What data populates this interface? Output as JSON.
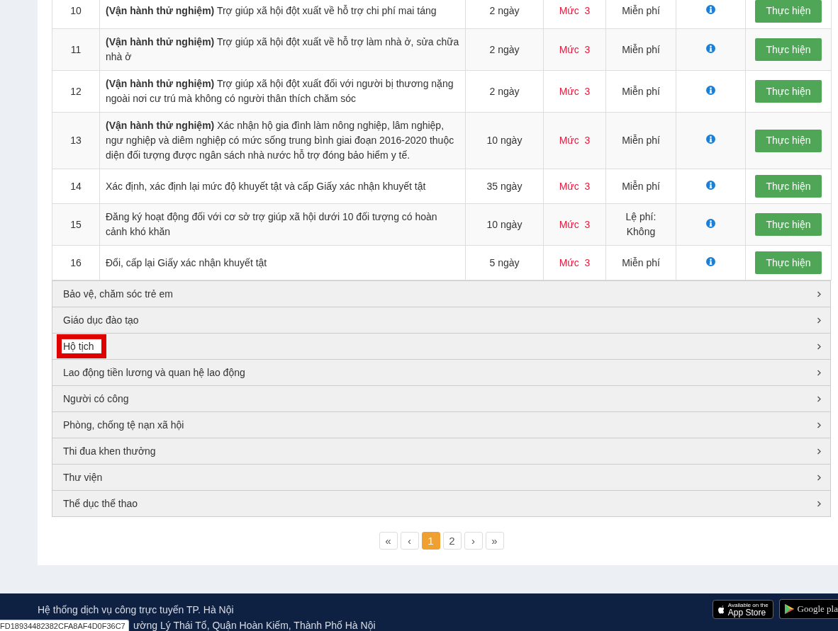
{
  "procedures": [
    {
      "column_1": "10",
      "column_2": "**(Vận hành thử nghiệm)** Trợ giúp xã hội đột xuất về hỗ trợ chi phí mai táng",
      "column_3": "2 ngày",
      "column_4": "Mức  3",
      "column_5": "Miễn phí",
      "button": "Thực hiện"
    },
    {
      "column_1": "11",
      "column_2": "**(Vận hành thử nghiệm)** Trợ giúp xã hội đột xuất về hỗ trợ làm nhà ở, sửa chữa nhà ở",
      "column_3": "2 ngày",
      "column_4": "Mức  3",
      "column_5": "Miễn phí",
      "button": "Thực hiện"
    },
    {
      "column_1": "12",
      "column_2": "**(Vận hành thử nghiệm)** Trợ giúp xã hội đột xuất đối với người bị thương nặng ngoài nơi cư trú mà không có người thân thích chăm sóc",
      "column_3": "2 ngày",
      "column_4": "Mức  3",
      "column_5": "Miễn phí",
      "button": "Thực hiện"
    },
    {
      "column_1": "13",
      "column_2": "**(Vận hành thử nghiệm)** Xác nhận hộ gia đình làm nông nghiệp, lâm nghiệp, ngư nghiệp và diêm nghiệp có mức sống trung bình giai đoạn 2016-2020 thuộc diện đối tượng được ngân sách nhà nước hỗ trợ đóng bảo hiểm y tế.",
      "column_3": "10 ngày",
      "column_4": "Mức  3",
      "column_5": "Miễn phí",
      "button": "Thực hiện"
    },
    {
      "column_1": "14",
      "column_2": "Xác định, xác định lại mức độ khuyết tật và cấp Giấy xác nhận khuyết tật",
      "column_3": "35 ngày",
      "column_4": "Mức  3",
      "column_5": "Miễn phí",
      "button": "Thực hiện"
    },
    {
      "column_1": "15",
      "column_2": "Đăng ký hoạt động đối với cơ sở trợ giúp xã hội dưới 10 đối tượng có hoàn cảnh khó khăn",
      "column_3": "10 ngày",
      "column_4": "Mức  3",
      "column_5": "Lệ phí: Không",
      "button": "Thực hiện"
    },
    {
      "column_1": "16",
      "column_2": "Đổi, cấp lại Giấy xác nhận khuyết tật",
      "column_3": "5 ngày",
      "column_4": "Mức  3",
      "column_5": "Miễn phí",
      "button": "Thực hiện"
    }
  ],
  "categories": [
    {
      "label": "Bảo vệ, chăm sóc trẻ em",
      "highlighted": false
    },
    {
      "label": "Giáo dục đào tạo",
      "highlighted": false
    },
    {
      "label": "Hộ tịch",
      "highlighted": true
    },
    {
      "label": "Lao động tiền lương và quan hệ lao động",
      "highlighted": false
    },
    {
      "label": "Người có công",
      "highlighted": false
    },
    {
      "label": "Phòng, chống tệ nạn xã hội",
      "highlighted": false
    },
    {
      "label": "Thi đua khen thưởng",
      "highlighted": false
    },
    {
      "label": "Thư viện",
      "highlighted": false
    },
    {
      "label": "Thể dục thể thao",
      "highlighted": false
    }
  ],
  "pagination": [
    {
      "label": "«",
      "selected": false
    },
    {
      "label": "‹",
      "selected": false
    },
    {
      "label": "1",
      "selected": true
    },
    {
      "label": "2",
      "selected": false
    },
    {
      "label": "›",
      "selected": false
    },
    {
      "label": "»",
      "selected": false
    }
  ],
  "footer": {
    "lines": [
      "Hệ thống dịch vụ công trực tuyến TP. Hà Nội",
      "ường Lý Thái Tổ, Quận Hoàn Kiếm, Thành Phố Hà Nội"
    ],
    "app_store": {
      "small": "Available on the",
      "big": "App Store"
    },
    "google_play": {
      "big": "Google pla"
    }
  },
  "status_url": "FD18934482382CFA8AF4D0F36C7"
}
